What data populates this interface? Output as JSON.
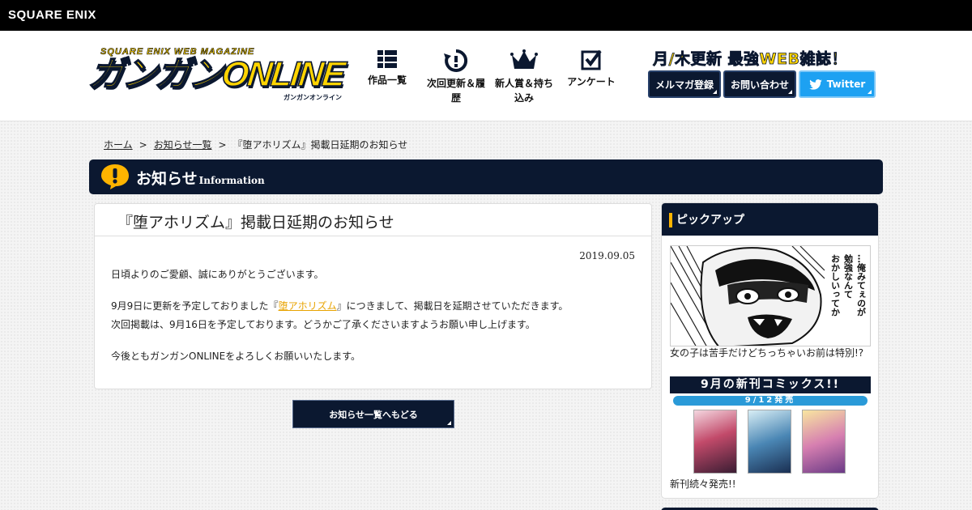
{
  "topbar": {
    "brand": "SQUARE ENIX"
  },
  "header": {
    "logo": {
      "subtitle": "SQUARE ENIX WEB MAGAZINE",
      "title": "ガンガンONLINE",
      "kana": "ガンガンオンライン"
    },
    "nav": [
      {
        "label": "作品一覧",
        "icon": "grid-list-icon"
      },
      {
        "label": "次回更新＆履歴",
        "icon": "clock-refresh-icon"
      },
      {
        "label": "新人賞＆持ち込み",
        "icon": "crown-icon"
      },
      {
        "label": "アンケート",
        "icon": "checkbox-icon"
      }
    ],
    "catchphrase": "月/木更新 最強WEB雑誌！",
    "buttons": {
      "newsletter": "メルマガ登録",
      "contact": "お問い合わせ",
      "twitter": "Twitter"
    }
  },
  "breadcrumb": {
    "home": "ホーム",
    "list": "お知らせ一覧",
    "current": "『堕アホリズム』掲載日延期のお知らせ",
    "separator": ">"
  },
  "section": {
    "title": "お知らせ",
    "title_en": "Information"
  },
  "article": {
    "title": "『堕アホリズム』掲載日延期のお知らせ",
    "date": "2019.09.05",
    "p1": "日頃よりのご愛顧、誠にありがとうございます。",
    "p2_before": "9月9日に更新を予定しておりました『",
    "p2_link": "堕アホリズム",
    "p2_after": "』につきまして、掲載日を延期させていただきます。",
    "p3": "次回掲載は、9月16日を予定しております。どうかご了承くださいますようお願い申し上げます。",
    "p4": "今後ともガンガンONLINEをよろしくお願いいたします。"
  },
  "back_button": "お知らせ一覧へもどる",
  "sidebar": {
    "title": "ピックアップ",
    "pickup": {
      "speech": "…俺みてぇのが勉強なんておかしいってか",
      "caption": "女の子は苦手だけどちっちゃいお前は特別!?"
    },
    "comics": {
      "banner_title": "9月の新刊コミックス!!",
      "banner_date": "9/12発売",
      "caption": "新刊続々発売!!"
    }
  },
  "colors": {
    "navy": "#0b1830",
    "yellow": "#ffd400",
    "twitter": "#1da1f2",
    "link": "#e8a300"
  }
}
